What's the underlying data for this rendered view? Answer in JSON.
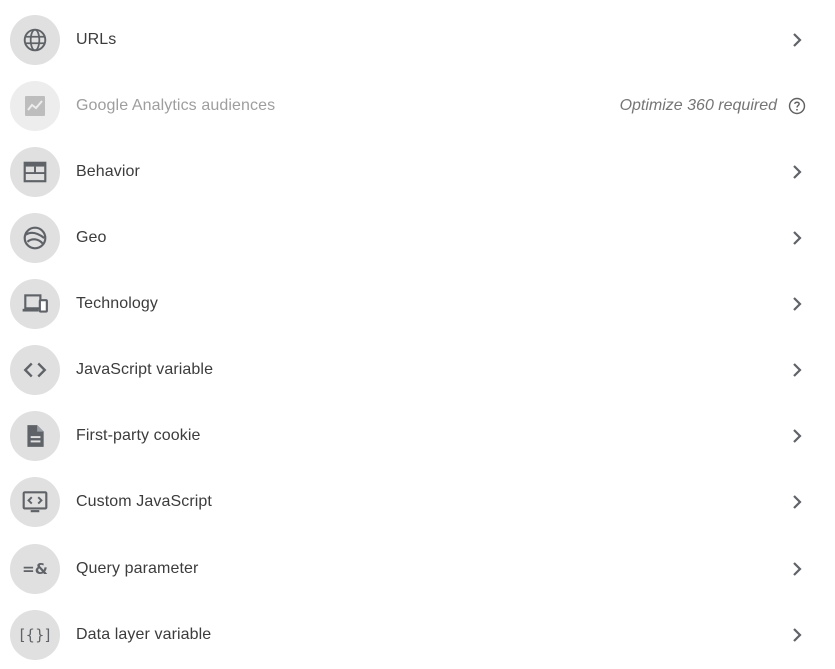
{
  "items": [
    {
      "label": "URLs",
      "icon": "globe-icon"
    },
    {
      "label": "Google Analytics audiences",
      "icon": "trending-chart-icon",
      "note": "Optimize 360 required",
      "disabled": true
    },
    {
      "label": "Behavior",
      "icon": "web-layout-icon"
    },
    {
      "label": "Geo",
      "icon": "earth-icon"
    },
    {
      "label": "Technology",
      "icon": "devices-icon"
    },
    {
      "label": "JavaScript variable",
      "icon": "code-icon"
    },
    {
      "label": "First-party cookie",
      "icon": "document-icon"
    },
    {
      "label": "Custom JavaScript",
      "icon": "screen-code-icon"
    },
    {
      "label": "Query parameter",
      "icon": "query-icon",
      "icon_text": "=&"
    },
    {
      "label": "Data layer variable",
      "icon": "data-layer-icon",
      "icon_text": "[{}]"
    }
  ],
  "colors": {
    "icon_bg": "#e0e0e0",
    "icon_fg": "#5f6368",
    "text": "#3c3c3c",
    "disabled_text": "#9e9e9e",
    "note_text": "#757575"
  }
}
